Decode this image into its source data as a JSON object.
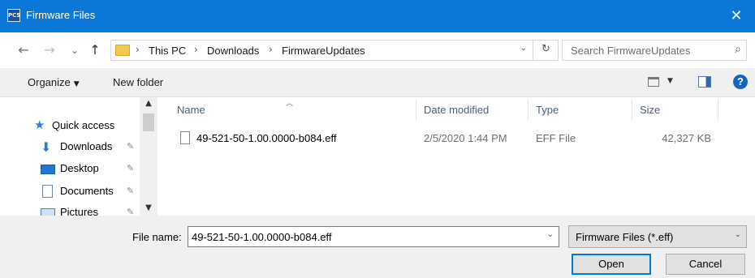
{
  "window": {
    "title": "Firmware Files",
    "app_badge": "PCS",
    "close_glyph": "✕"
  },
  "nav_buttons": {
    "back": "←",
    "forward": "→",
    "recent": "⌄",
    "up": "↑"
  },
  "address": {
    "crumbs": [
      "This PC",
      "Downloads",
      "FirmwareUpdates"
    ],
    "separator": "›",
    "refresh_glyph": "↻"
  },
  "search": {
    "placeholder": "Search FirmwareUpdates",
    "icon": "search-icon"
  },
  "toolbar": {
    "organize_label": "Organize",
    "new_folder_label": "New folder",
    "help_label": "?"
  },
  "sidebar": {
    "items": [
      {
        "label": "Quick access",
        "icon": "star-icon"
      },
      {
        "label": "Downloads",
        "icon": "download-icon",
        "pinned": true
      },
      {
        "label": "Desktop",
        "icon": "desktop-icon",
        "pinned": true
      },
      {
        "label": "Documents",
        "icon": "documents-icon",
        "pinned": true
      },
      {
        "label": "Pictures",
        "icon": "pictures-icon",
        "pinned": true
      }
    ]
  },
  "file_list": {
    "columns": [
      "Name",
      "Date modified",
      "Type",
      "Size"
    ],
    "rows": [
      {
        "name": "49-521-50-1.00.0000-b084.eff",
        "date_modified": "2/5/2020 1:44 PM",
        "type": "EFF File",
        "size": "42,327 KB"
      }
    ]
  },
  "footer": {
    "file_name_label": "File name:",
    "file_name_value": "49-521-50-1.00.0000-b084.eff",
    "file_type_filter": "Firmware Files (*.eff)",
    "open_label": "Open",
    "cancel_label": "Cancel"
  },
  "colors": {
    "titlebar": "#0b78d7",
    "accent": "#0078d7",
    "toolbar_bg": "#f0f0f0"
  }
}
